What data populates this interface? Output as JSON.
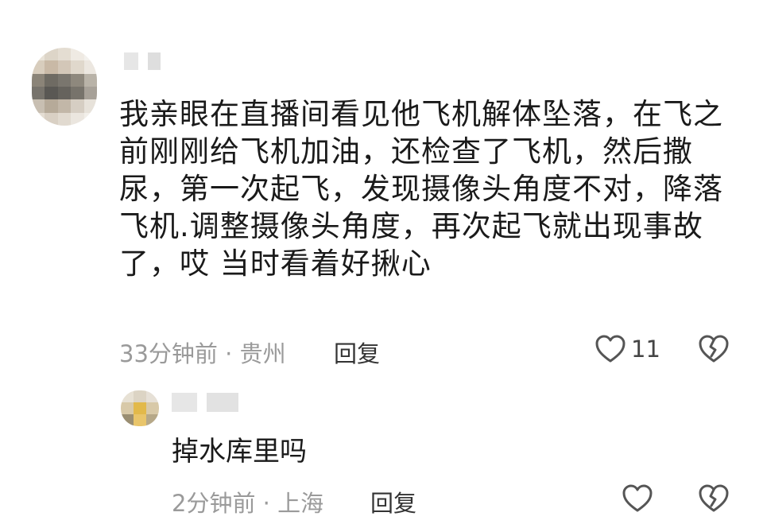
{
  "comment": {
    "text": "我亲眼在直播间看见他飞机解体坠落，在飞之前刚刚给飞机加油，还检查了飞机，然后撒尿，第一次起飞，发现摄像头角度不对，降落飞机.调整摄像头角度，再次起飞就出现事故了，哎 当时看着好揪心",
    "time": "33分钟前",
    "location": "贵州",
    "reply_label": "回复",
    "likes": "11",
    "like_icon": "heart-outline-icon",
    "dislike_icon": "broken-heart-icon"
  },
  "reply": {
    "text": "掉水库里吗",
    "time": "2分钟前",
    "location": "上海",
    "reply_label": "回复",
    "like_icon": "heart-outline-icon",
    "dislike_icon": "broken-heart-icon"
  },
  "meta_separator": " · ",
  "colors": {
    "text": "#1a1a1a",
    "meta": "#9a9a9a",
    "icon": "#555555"
  }
}
